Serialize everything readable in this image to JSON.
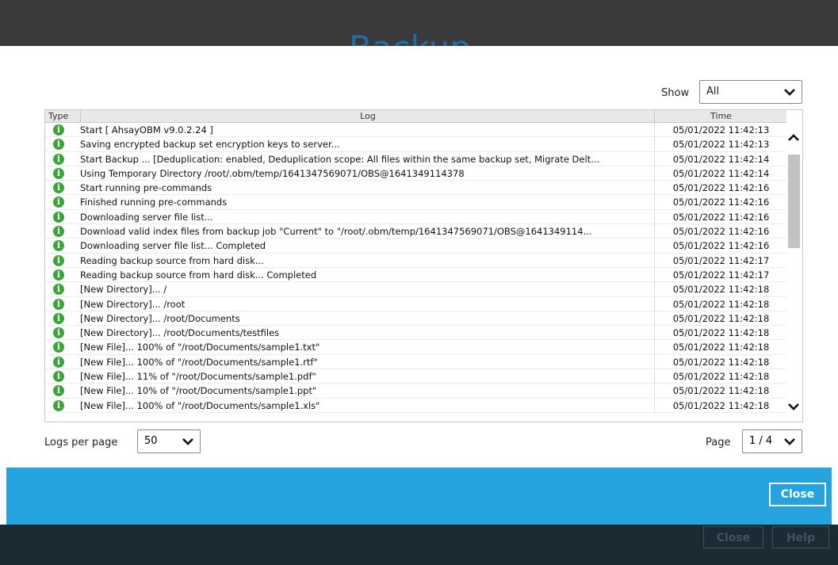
{
  "background": {
    "title_fragment": "Backup",
    "buttons": [
      "Close",
      "Help"
    ]
  },
  "dialog": {
    "show_label": "Show",
    "show_value": "All",
    "columns": {
      "type": "Type",
      "log": "Log",
      "time": "Time"
    },
    "rows": [
      {
        "log": "Start [ AhsayOBM v9.0.2.24 ]",
        "time": "05/01/2022 11:42:13"
      },
      {
        "log": "Saving encrypted backup set encryption keys to server...",
        "time": "05/01/2022 11:42:13"
      },
      {
        "log": "Start Backup ... [Deduplication: enabled, Deduplication scope: All files within the same backup set, Migrate Delt...",
        "time": "05/01/2022 11:42:14"
      },
      {
        "log": "Using Temporary Directory /root/.obm/temp/1641347569071/OBS@1641349114378",
        "time": "05/01/2022 11:42:14"
      },
      {
        "log": "Start running pre-commands",
        "time": "05/01/2022 11:42:16"
      },
      {
        "log": "Finished running pre-commands",
        "time": "05/01/2022 11:42:16"
      },
      {
        "log": "Downloading server file list...",
        "time": "05/01/2022 11:42:16"
      },
      {
        "log": "Download valid index files from backup job \"Current\" to \"/root/.obm/temp/1641347569071/OBS@1641349114...",
        "time": "05/01/2022 11:42:16"
      },
      {
        "log": "Downloading server file list... Completed",
        "time": "05/01/2022 11:42:16"
      },
      {
        "log": "Reading backup source from hard disk...",
        "time": "05/01/2022 11:42:17"
      },
      {
        "log": "Reading backup source from hard disk... Completed",
        "time": "05/01/2022 11:42:17"
      },
      {
        "log": "[New Directory]... /",
        "time": "05/01/2022 11:42:18"
      },
      {
        "log": "[New Directory]... /root",
        "time": "05/01/2022 11:42:18"
      },
      {
        "log": "[New Directory]... /root/Documents",
        "time": "05/01/2022 11:42:18"
      },
      {
        "log": "[New Directory]... /root/Documents/testfiles",
        "time": "05/01/2022 11:42:18"
      },
      {
        "log": "[New File]... 100% of \"/root/Documents/sample1.txt\"",
        "time": "05/01/2022 11:42:18"
      },
      {
        "log": "[New File]... 100% of \"/root/Documents/sample1.rtf\"",
        "time": "05/01/2022 11:42:18"
      },
      {
        "log": "[New File]... 11% of \"/root/Documents/sample1.pdf\"",
        "time": "05/01/2022 11:42:18"
      },
      {
        "log": "[New File]... 10% of \"/root/Documents/sample1.ppt\"",
        "time": "05/01/2022 11:42:18"
      },
      {
        "log": "[New File]... 100% of \"/root/Documents/sample1.xls\"",
        "time": "05/01/2022 11:42:18"
      }
    ],
    "row_icon": "info-icon",
    "logs_per_page_label": "Logs per page",
    "logs_per_page_value": "50",
    "page_label": "Page",
    "page_value": "1 / 4",
    "close_label": "Close",
    "accent_color": "#25a3de",
    "icon_color": "#3aa63a"
  }
}
